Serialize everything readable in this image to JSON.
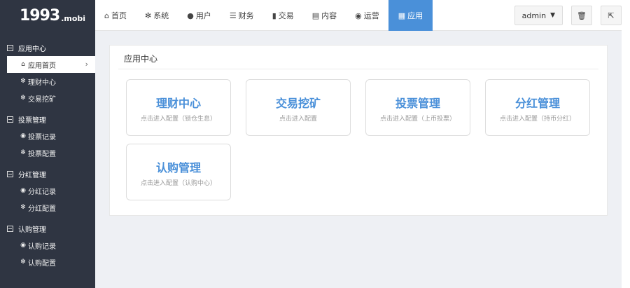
{
  "logo": {
    "main": "1993",
    "sub": ".mobi"
  },
  "sidebar": {
    "groups": [
      {
        "title": "应用中心",
        "items": [
          {
            "label": "应用首页",
            "icon": "home-icon",
            "active": true
          },
          {
            "label": "理财中心",
            "icon": "gear-icon"
          },
          {
            "label": "交易挖矿",
            "icon": "gear-icon"
          }
        ]
      },
      {
        "title": "投票管理",
        "items": [
          {
            "label": "投票记录",
            "icon": "globe-icon"
          },
          {
            "label": "投票配置",
            "icon": "gear-icon"
          }
        ]
      },
      {
        "title": "分红管理",
        "items": [
          {
            "label": "分红记录",
            "icon": "globe-icon"
          },
          {
            "label": "分红配置",
            "icon": "gear-icon"
          }
        ]
      },
      {
        "title": "认购管理",
        "items": [
          {
            "label": "认购记录",
            "icon": "globe-icon"
          },
          {
            "label": "认购配置",
            "icon": "gear-icon"
          }
        ]
      }
    ]
  },
  "topnav": {
    "items": [
      {
        "label": "首页",
        "icon": "home-icon"
      },
      {
        "label": "系统",
        "icon": "gear-icon"
      },
      {
        "label": "用户",
        "icon": "user-icon"
      },
      {
        "label": "财务",
        "icon": "list-icon"
      },
      {
        "label": "交易",
        "icon": "bar-chart-icon"
      },
      {
        "label": "内容",
        "icon": "document-icon"
      },
      {
        "label": "运营",
        "icon": "globe-icon"
      },
      {
        "label": "应用",
        "icon": "grid-icon",
        "active": true
      }
    ],
    "user": "admin"
  },
  "main": {
    "title": "应用中心",
    "cards": [
      {
        "title": "理财中心",
        "desc": "点击进入配置（锁仓生息）"
      },
      {
        "title": "交易挖矿",
        "desc": "点击进入配置"
      },
      {
        "title": "投票管理",
        "desc": "点击进入配置（上币投票）"
      },
      {
        "title": "分红管理",
        "desc": "点击进入配置（持币分红）"
      },
      {
        "title": "认购管理",
        "desc": "点击进入配置（认购中心）"
      }
    ]
  },
  "colors": {
    "accent": "#4a90d9",
    "sidebar": "#2f3542"
  }
}
